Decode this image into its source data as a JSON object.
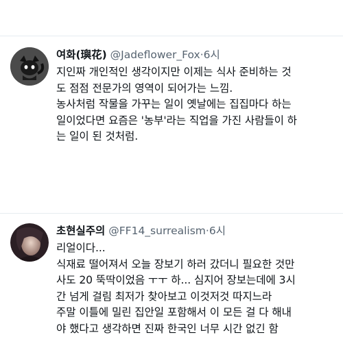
{
  "tweets": [
    {
      "display_name": "여화(璵花)",
      "handle": "@Jadeflower_Fox",
      "separator": "·",
      "time": "6시",
      "lines": [
        "지인짜 개인적인 생각이지만 이제는 식사 준비하는 것",
        "도 점점 전문가의 영역이 되어가는 느낌.",
        "농사처럼 작물을 가꾸는 일이 옛날에는 집집마다 하는",
        "일이었다면 요즘은 '농부'라는 직업을 가진 사람들이 하",
        "는 일이 된 것처럼."
      ],
      "avatar": "fox-avatar-icon"
    },
    {
      "display_name": "초현실주의",
      "handle": "@FF14_surrealism",
      "separator": "·",
      "time": "6시",
      "lines": [
        "리얼이다...",
        "식재료 떨어져서 오늘 장보기 하러 갔더니 필요한 것만",
        "사도 20 뚝딱이었음 ㅜㅜ 하... 심지어 장보는데에 3시",
        "간 넘게 걸림 최저가 찾아보고 이것저것 따지느라",
        "주말 이틀에 밀린 집안일 포함해서 이 모든 걸 다 해내",
        "야 했다고 생각하면 진짜 한국인 너무 시간 없긴 함"
      ],
      "avatar": "portrait-avatar"
    }
  ],
  "colors": {
    "text": "#0f1419",
    "secondary": "#566370",
    "divider": "#e6ecf0"
  }
}
